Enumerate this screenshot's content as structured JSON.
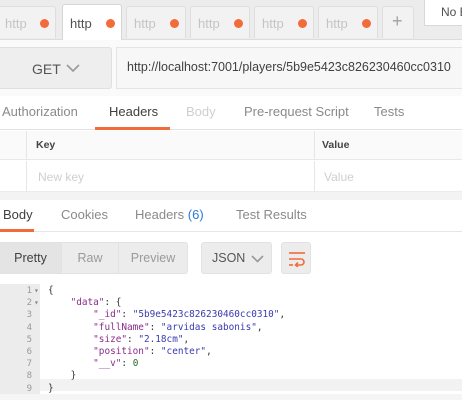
{
  "tabs": [
    {
      "label": "http",
      "active": false
    },
    {
      "label": "http",
      "active": true
    },
    {
      "label": "http",
      "active": false
    },
    {
      "label": "http",
      "active": false
    },
    {
      "label": "http",
      "active": false
    },
    {
      "label": "http",
      "active": false
    }
  ],
  "new_tab_label": "+",
  "environment": {
    "label": "No E"
  },
  "request": {
    "method": "GET",
    "url": "http://localhost:7001/players/5b9e5423c826230460cc0310"
  },
  "request_tabs": [
    "Authorization",
    "Headers",
    "Body",
    "Pre-request Script",
    "Tests"
  ],
  "headers_table": {
    "columns": [
      "Key",
      "Value"
    ],
    "placeholders": {
      "key": "New key",
      "value": "Value"
    }
  },
  "response_tabs": {
    "body": "Body",
    "cookies": "Cookies",
    "headers": "Headers",
    "headers_count": "(6)",
    "test_results": "Test Results"
  },
  "view_modes": [
    "Pretty",
    "Raw",
    "Preview"
  ],
  "format": "JSON",
  "code_lines": [
    {
      "num": "1",
      "fold": "▾",
      "parts": [
        {
          "t": "{",
          "c": "pn"
        }
      ]
    },
    {
      "num": "2",
      "fold": "▾",
      "parts": [
        {
          "t": "    ",
          "c": "pn"
        },
        {
          "t": "\"data\"",
          "c": "k"
        },
        {
          "t": ": {",
          "c": "pn"
        }
      ]
    },
    {
      "num": "3",
      "fold": "",
      "parts": [
        {
          "t": "        ",
          "c": "pn"
        },
        {
          "t": "\"_id\"",
          "c": "k"
        },
        {
          "t": ": ",
          "c": "pn"
        },
        {
          "t": "\"5b9e5423c826230460cc0310\"",
          "c": "s"
        },
        {
          "t": ",",
          "c": "pn"
        }
      ]
    },
    {
      "num": "4",
      "fold": "",
      "parts": [
        {
          "t": "        ",
          "c": "pn"
        },
        {
          "t": "\"fullName\"",
          "c": "k"
        },
        {
          "t": ": ",
          "c": "pn"
        },
        {
          "t": "\"arvidas sabonis\"",
          "c": "s"
        },
        {
          "t": ",",
          "c": "pn"
        }
      ]
    },
    {
      "num": "5",
      "fold": "",
      "parts": [
        {
          "t": "        ",
          "c": "pn"
        },
        {
          "t": "\"size\"",
          "c": "k"
        },
        {
          "t": ": ",
          "c": "pn"
        },
        {
          "t": "\"2.18cm\"",
          "c": "s"
        },
        {
          "t": ",",
          "c": "pn"
        }
      ]
    },
    {
      "num": "6",
      "fold": "",
      "parts": [
        {
          "t": "        ",
          "c": "pn"
        },
        {
          "t": "\"position\"",
          "c": "k"
        },
        {
          "t": ": ",
          "c": "pn"
        },
        {
          "t": "\"center\"",
          "c": "s"
        },
        {
          "t": ",",
          "c": "pn"
        }
      ]
    },
    {
      "num": "7",
      "fold": "",
      "parts": [
        {
          "t": "        ",
          "c": "pn"
        },
        {
          "t": "\"__v\"",
          "c": "k"
        },
        {
          "t": ": ",
          "c": "pn"
        },
        {
          "t": "0",
          "c": "n"
        }
      ]
    },
    {
      "num": "8",
      "fold": "",
      "parts": [
        {
          "t": "    }",
          "c": "pn"
        }
      ]
    },
    {
      "num": "9",
      "fold": "",
      "parts": [
        {
          "t": "}",
          "c": "pn"
        }
      ]
    }
  ],
  "colors": {
    "accent": "#f26b3a",
    "count": "#2a7ad6"
  }
}
